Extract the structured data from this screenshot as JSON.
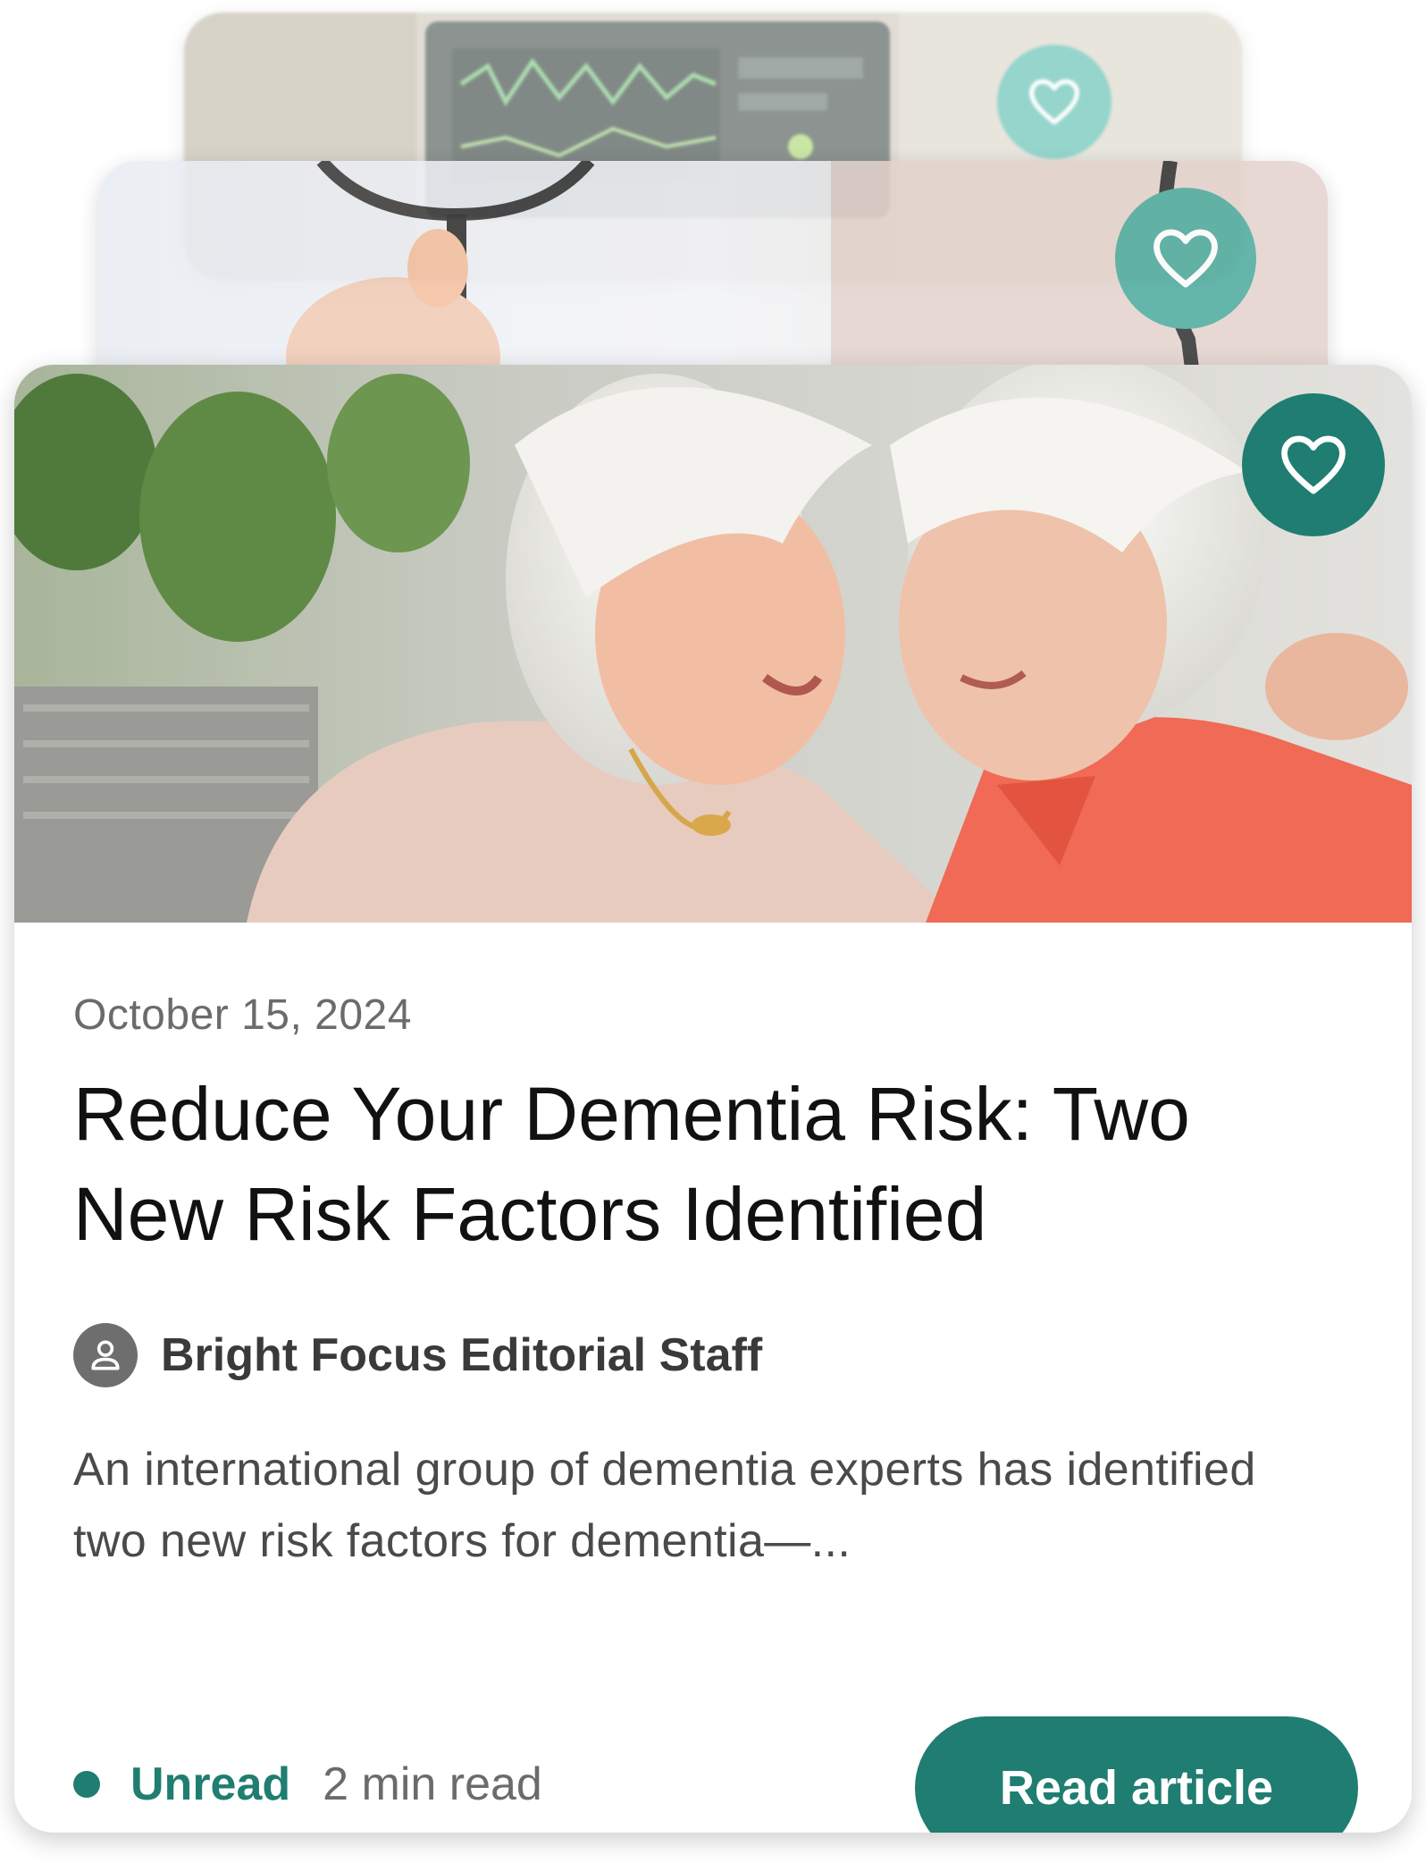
{
  "cards_stack": {
    "back_card": {
      "image": "medical-monitor-photo",
      "favorite_icon": "heart-outline-icon",
      "favorite_color": "#3fb3a2"
    },
    "middle_card": {
      "image": "doctor-stethoscope-photo",
      "favorite_icon": "heart-outline-icon",
      "favorite_color": "#4aa99c"
    }
  },
  "article": {
    "image": "two-women-embracing-photo",
    "favorite_icon": "heart-outline-icon",
    "date": "October 15, 2024",
    "title": "Reduce Your Dementia Risk: Two New Risk Factors Identified",
    "author": {
      "icon": "person-icon",
      "name": "Bright Focus Editorial Staff"
    },
    "excerpt": "An international group of dementia experts has identified two new risk factors for dementia—...",
    "status": "Unread",
    "read_time": "2 min read",
    "cta_label": "Read article"
  },
  "colors": {
    "accent": "#1f7d71",
    "text_primary": "#111111",
    "text_secondary": "#6b6b6b"
  }
}
